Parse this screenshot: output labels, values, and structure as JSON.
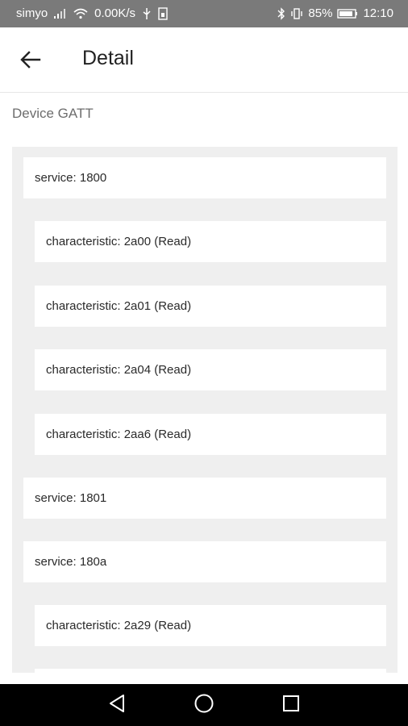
{
  "status_bar": {
    "carrier": "simyo",
    "speed": "0.00K/s",
    "battery": "85%",
    "time": "12:10"
  },
  "app_bar": {
    "title": "Detail"
  },
  "section": {
    "label": "Device GATT"
  },
  "gatt_rows": [
    {
      "kind": "service",
      "text": "service: 1800"
    },
    {
      "kind": "characteristic",
      "text": "characteristic: 2a00 (Read)"
    },
    {
      "kind": "characteristic",
      "text": "characteristic: 2a01 (Read)"
    },
    {
      "kind": "characteristic",
      "text": "characteristic: 2a04 (Read)"
    },
    {
      "kind": "characteristic",
      "text": "characteristic: 2aa6 (Read)"
    },
    {
      "kind": "service",
      "text": "service: 1801"
    },
    {
      "kind": "service",
      "text": "service: 180a"
    },
    {
      "kind": "characteristic",
      "text": "characteristic: 2a29 (Read)"
    },
    {
      "kind": "characteristic",
      "text": ""
    }
  ],
  "icons": {
    "back": "arrow-left-icon",
    "nav_back": "triangle-back-icon",
    "nav_home": "circle-home-icon",
    "nav_recents": "square-recents-icon"
  }
}
